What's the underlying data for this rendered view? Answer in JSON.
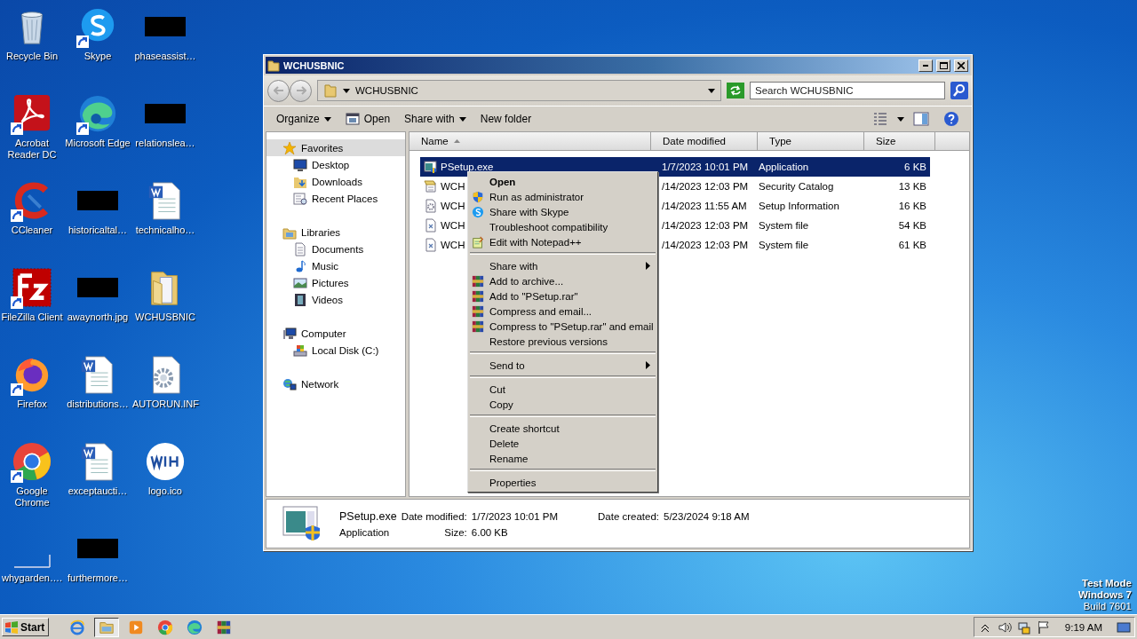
{
  "desktop": {
    "icons": [
      {
        "label": "Recycle Bin",
        "kind": "recycle",
        "shortcut": false
      },
      {
        "label": "Skype",
        "kind": "skype",
        "shortcut": true
      },
      {
        "label": "phaseassist…",
        "kind": "redacted",
        "shortcut": false
      },
      {
        "label": "Acrobat Reader DC",
        "kind": "acrobat",
        "shortcut": true
      },
      {
        "label": "Microsoft Edge",
        "kind": "edge",
        "shortcut": true
      },
      {
        "label": "relationslea…",
        "kind": "redacted",
        "shortcut": false
      },
      {
        "label": "CCleaner",
        "kind": "ccleaner",
        "shortcut": true
      },
      {
        "label": "historicaltal…",
        "kind": "redacted",
        "shortcut": false
      },
      {
        "label": "technicalho…",
        "kind": "word",
        "shortcut": false
      },
      {
        "label": "FileZilla Client",
        "kind": "filezilla",
        "shortcut": true
      },
      {
        "label": "awaynorth.jpg",
        "kind": "redacted",
        "shortcut": false
      },
      {
        "label": "WCHUSBNIC",
        "kind": "folder",
        "shortcut": false
      },
      {
        "label": "Firefox",
        "kind": "firefox",
        "shortcut": true
      },
      {
        "label": "distributions…",
        "kind": "word",
        "shortcut": false
      },
      {
        "label": "AUTORUN.INF",
        "kind": "settings-file",
        "shortcut": false
      },
      {
        "label": "Google Chrome",
        "kind": "chrome",
        "shortcut": true
      },
      {
        "label": "exceptaucti…",
        "kind": "word",
        "shortcut": false
      },
      {
        "label": "logo.ico",
        "kind": "logo",
        "shortcut": false
      },
      {
        "label": "whygarden….",
        "kind": "blank",
        "shortcut": false
      },
      {
        "label": "furthermore…",
        "kind": "redacted",
        "shortcut": false
      }
    ]
  },
  "explorer": {
    "title": "WCHUSBNIC",
    "address": "WCHUSBNIC",
    "search_placeholder": "Search WCHUSBNIC",
    "toolbar": [
      {
        "label": "Organize",
        "dropdown": true
      },
      {
        "label": "Open",
        "dropdown": false
      },
      {
        "label": "Share with",
        "dropdown": true
      },
      {
        "label": "New folder",
        "dropdown": false
      }
    ],
    "nav": [
      {
        "label": "Favorites",
        "selected": true,
        "children": [
          {
            "label": "Desktop",
            "selected": false
          },
          {
            "label": "Downloads",
            "selected": false
          },
          {
            "label": "Recent Places",
            "selected": false
          }
        ]
      },
      {
        "label": "Libraries",
        "selected": false,
        "children": [
          {
            "label": "Documents",
            "selected": false
          },
          {
            "label": "Music",
            "selected": false
          },
          {
            "label": "Pictures",
            "selected": false
          },
          {
            "label": "Videos",
            "selected": false
          }
        ]
      },
      {
        "label": "Computer",
        "selected": false,
        "children": [
          {
            "label": "Local Disk (C:)",
            "selected": false
          }
        ]
      },
      {
        "label": "Network",
        "selected": false
      }
    ],
    "columns": [
      {
        "label": "Name",
        "sorted": true
      },
      {
        "label": "Date modified",
        "sorted": false
      },
      {
        "label": "Type",
        "sorted": false
      },
      {
        "label": "Size",
        "sorted": false
      }
    ],
    "rows": [
      {
        "name": "PSetup.exe",
        "kind": "exe",
        "date": "1/7/2023 10:01 PM",
        "type": "Application",
        "size": "6 KB",
        "selected": true
      },
      {
        "name": "WCH",
        "kind": "catalog",
        "date": "/14/2023 12:03 PM",
        "type": "Security Catalog",
        "size": "13 KB",
        "selected": false
      },
      {
        "name": "WCH",
        "kind": "inf",
        "date": "/14/2023 11:55 AM",
        "type": "Setup Information",
        "size": "16 KB",
        "selected": false
      },
      {
        "name": "WCH",
        "kind": "sys",
        "date": "/14/2023 12:03 PM",
        "type": "System file",
        "size": "54 KB",
        "selected": false
      },
      {
        "name": "WCH",
        "kind": "sys",
        "date": "/14/2023 12:03 PM",
        "type": "System file",
        "size": "61 KB",
        "selected": false
      }
    ],
    "details": {
      "name": "PSetup.exe",
      "type": "Application",
      "fields": [
        {
          "label": "Date modified:",
          "value": "1/7/2023 10:01 PM"
        },
        {
          "label": "Date created:",
          "value": "5/23/2024 9:18 AM"
        },
        {
          "label": "Size:",
          "value": "6.00 KB"
        }
      ]
    }
  },
  "context_menu": {
    "items": [
      {
        "kind": "plain",
        "label": "Open",
        "default": true,
        "submenu": false
      },
      {
        "kind": "shield",
        "label": "Run as administrator",
        "default": false,
        "submenu": false
      },
      {
        "kind": "skype",
        "label": "Share with Skype",
        "default": false,
        "submenu": false
      },
      {
        "kind": "plain",
        "label": "Troubleshoot compatibility",
        "default": false,
        "submenu": false
      },
      {
        "kind": "notepad",
        "label": "Edit with Notepad++",
        "default": false,
        "submenu": false
      },
      {
        "kind": "separator"
      },
      {
        "kind": "plain",
        "label": "Share with",
        "default": false,
        "submenu": true
      },
      {
        "kind": "winrar",
        "label": "Add to archive...",
        "default": false,
        "submenu": false
      },
      {
        "kind": "winrar",
        "label": "Add to \"PSetup.rar\"",
        "default": false,
        "submenu": false
      },
      {
        "kind": "winrar",
        "label": "Compress and email...",
        "default": false,
        "submenu": false
      },
      {
        "kind": "winrar",
        "label": "Compress to \"PSetup.rar\" and email",
        "default": false,
        "submenu": false
      },
      {
        "kind": "plain",
        "label": "Restore previous versions",
        "default": false,
        "submenu": false
      },
      {
        "kind": "separator"
      },
      {
        "kind": "plain",
        "label": "Send to",
        "default": false,
        "submenu": true
      },
      {
        "kind": "separator"
      },
      {
        "kind": "plain",
        "label": "Cut",
        "default": false,
        "submenu": false
      },
      {
        "kind": "plain",
        "label": "Copy",
        "default": false,
        "submenu": false
      },
      {
        "kind": "separator"
      },
      {
        "kind": "plain",
        "label": "Create shortcut",
        "default": false,
        "submenu": false
      },
      {
        "kind": "plain",
        "label": "Delete",
        "default": false,
        "submenu": false
      },
      {
        "kind": "plain",
        "label": "Rename",
        "default": false,
        "submenu": false
      },
      {
        "kind": "separator"
      },
      {
        "kind": "plain",
        "label": "Properties",
        "default": false,
        "submenu": false
      }
    ]
  },
  "os_notice": [
    "Test Mode",
    "Windows 7",
    "Build 7601"
  ],
  "taskbar": {
    "start": "Start",
    "apps": [
      {
        "kind": "ie",
        "selected": false
      },
      {
        "kind": "explorer",
        "selected": true
      },
      {
        "kind": "media",
        "selected": false
      },
      {
        "kind": "chrome",
        "selected": false
      },
      {
        "kind": "edge",
        "selected": false
      },
      {
        "kind": "winrar",
        "selected": false
      }
    ],
    "clock": "9:19 AM"
  }
}
